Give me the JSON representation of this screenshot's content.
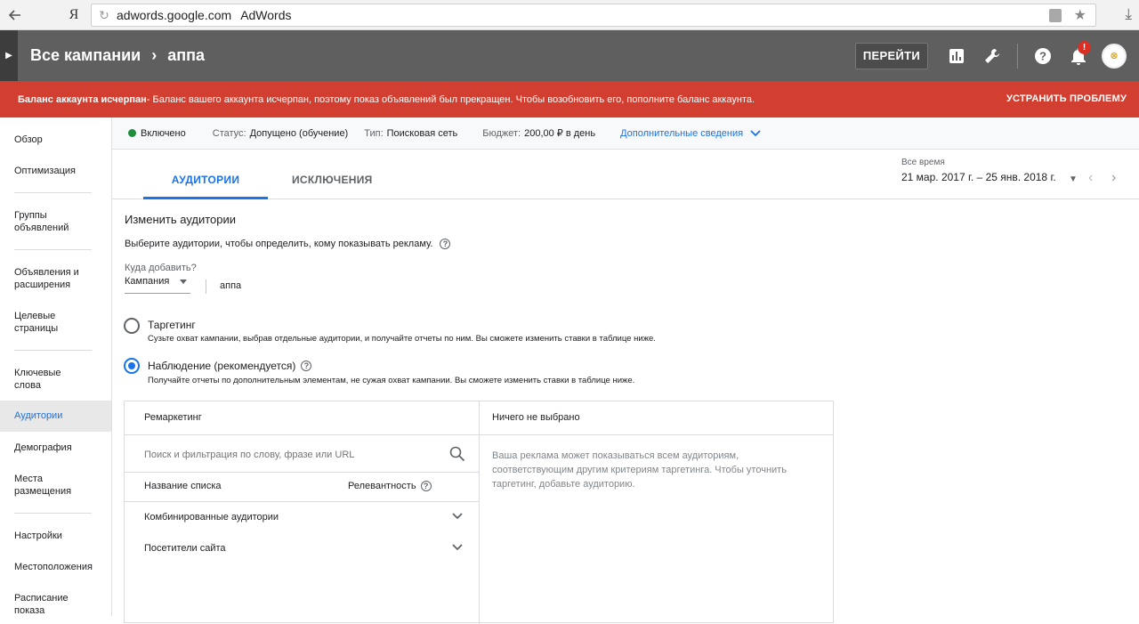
{
  "browser": {
    "back_icon": "arrow-left-icon",
    "yandex_logo": "Я",
    "domain": "adwords.google.com",
    "page_title": "AdWords"
  },
  "header": {
    "breadcrumb_root": "Все кампании",
    "breadcrumb_current": "аппа",
    "go_button": "ПЕРЕЙТИ",
    "notification_count": "!"
  },
  "alert": {
    "title": "Баланс аккаунта исчерпан",
    "message": " - Баланс вашего аккаунта исчерпан, поэтому показ объявлений был прекращен. Чтобы возобновить его, пополните баланс аккаунта.",
    "fix_label": "УСТРАНИТЬ ПРОБЛЕМУ",
    "color": "#d23f31"
  },
  "sidebar": {
    "items": [
      {
        "label": "Обзор"
      },
      {
        "label": "Оптимизация"
      },
      {
        "label": "Группы объявлений"
      },
      {
        "label": "Объявления и расширения"
      },
      {
        "label": "Целевые страницы"
      },
      {
        "label": "Ключевые слова"
      },
      {
        "label": "Аудитории",
        "active": true
      },
      {
        "label": "Демография"
      },
      {
        "label": "Места размещения"
      },
      {
        "label": "Настройки"
      },
      {
        "label": "Местоположения"
      },
      {
        "label": "Расписание показа"
      }
    ]
  },
  "status_row": {
    "state": "Включено",
    "status_label": "Статус:",
    "status_value": "Допущено (обучение)",
    "type_label": "Тип:",
    "type_value": "Поисковая сеть",
    "budget_label": "Бюджет:",
    "budget_value": "200,00 ₽ в день",
    "more_link": "Дополнительные сведения"
  },
  "tabs": {
    "audiences": "АУДИТОРИИ",
    "exclusions": "ИСКЛЮЧЕНИЯ",
    "active": "audiences"
  },
  "date_range": {
    "label": "Все время",
    "value": "21 мар. 2017 г. – 25 янв. 2018 г."
  },
  "edit": {
    "title": "Изменить аудитории",
    "description": "Выберите аудитории, чтобы определить, кому показывать рекламу.",
    "where_label": "Куда добавить?",
    "where_value": "Кампания",
    "where_target": "аппа",
    "targeting_title": "Таргетинг",
    "targeting_desc": "Сузьте охват кампании, выбрав отдельные аудитории, и получайте отчеты по ним. Вы сможете изменить ставки в таблице ниже.",
    "observation_title": "Наблюдение (рекомендуется)",
    "observation_desc": "Получайте отчеты по дополнительным элементам, не сужая охват кампании. Вы сможете изменить ставки в таблице ниже.",
    "selected_mode": "observation"
  },
  "panel": {
    "left_header": "Ремаркетинг",
    "search_placeholder": "Поиск и фильтрация по слову, фразе или URL",
    "col_name": "Название списка",
    "col_relevance": "Релевантность",
    "rows": [
      {
        "label": "Комбинированные аудитории"
      },
      {
        "label": "Посетители сайта"
      }
    ],
    "right_header": "Ничего не выбрано",
    "right_text": "Ваша реклама может показываться всем аудиториям, соответствующим другим критериям таргетинга. Чтобы уточнить таргетинг, добавьте аудиторию."
  },
  "colors": {
    "accent": "#1a73e8",
    "header_bg": "#5f5f5f",
    "status_on": "#1e8e3e"
  }
}
